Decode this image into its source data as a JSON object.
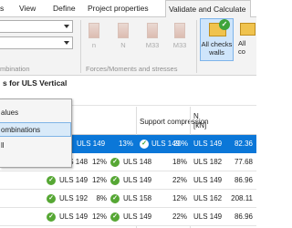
{
  "ribbon_tabs": [
    "View",
    "Define",
    "Project properties",
    "Validate and Calculate"
  ],
  "ribbon": {
    "group_combination_label": "mbination",
    "forces_buttons": [
      "n",
      "N",
      "M33",
      "M33"
    ],
    "group_forces_label": "Forces/Moments and stresses",
    "all_checks_line1": "All checks",
    "all_checks_line2": "walls",
    "partial_btn_line1": "All",
    "partial_btn_line2": "co"
  },
  "section_title": "s for ULS Vertical",
  "columns": {
    "support_compression": "Support compression",
    "n_label": "N",
    "n_unit": "[kN]"
  },
  "rows": [
    {
      "c1_label": "ULS 149",
      "c1_pct": "13%",
      "c2_label": "ULS 149",
      "c2_pct": "20%",
      "c3_label": "ULS 149",
      "c3_val": "82.36",
      "selected": true
    },
    {
      "c1_label": "",
      "c1_pct": "",
      "c2_label": "ULS 148",
      "c2_pct": "12%",
      "c3_label": "ULS 148",
      "c3_val": "18%",
      "c4_label": "ULS 182",
      "c4_val": "77.68",
      "selected": false
    },
    {
      "c1_label": "",
      "c1_pct": "",
      "c2_label": "ULS 149",
      "c2_pct": "12%",
      "c3_label": "ULS 149",
      "c3_val": "22%",
      "c4_label": "ULS 149",
      "c4_val": "86.96",
      "selected": false
    },
    {
      "c1_label": "",
      "c1_pct": "",
      "c2_label": "ULS 192",
      "c2_pct": "8%",
      "c3_label": "ULS 158",
      "c3_val": "12%",
      "c4_label": "ULS 162",
      "c4_val": "208.11",
      "selected": false
    },
    {
      "c1_label": "",
      "c1_pct": "",
      "c2_label": "ULS 149",
      "c2_pct": "12%",
      "c3_label": "ULS 149",
      "c3_val": "22%",
      "c4_label": "ULS 149",
      "c4_val": "86.96",
      "selected": false
    }
  ],
  "menu": {
    "items": [
      "alues",
      "ombinations",
      "ll"
    ],
    "highlighted_index": 1
  },
  "colors": {
    "selection": "#0b77d8",
    "check_ok": "#56a734",
    "button_active_bg": "#cfe5fb"
  }
}
